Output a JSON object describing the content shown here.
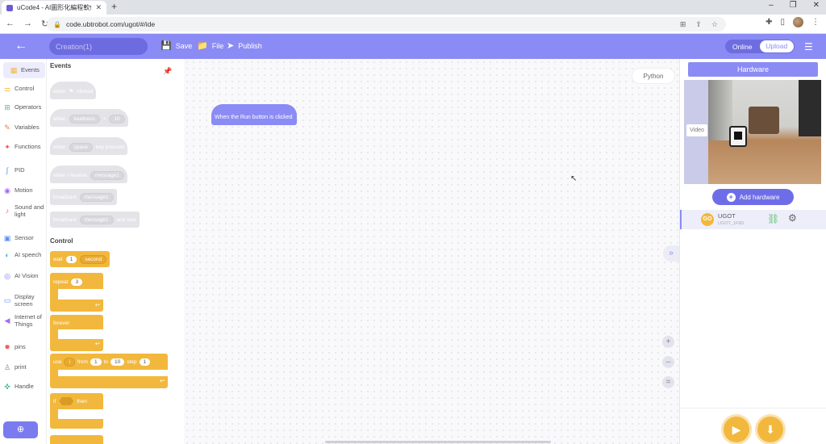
{
  "browser": {
    "tab_title": "uCode4 - AI圖形化編程軟件",
    "tab_close": "✕",
    "new_tab": "+",
    "url": "code.ubtrobot.com/ugot/#/ide",
    "win_min": "–",
    "win_max": "❐",
    "win_close": "✕"
  },
  "header": {
    "back_glyph": "←",
    "project_name": "Creation(1)",
    "save_label": "Save",
    "file_label": "File",
    "publish_label": "Publish",
    "mode_online": "Online",
    "mode_upload": "Upload"
  },
  "categories": [
    {
      "label": "Events",
      "icon": "calendar-icon",
      "color": "#f2b83d"
    },
    {
      "label": "Control",
      "icon": "sliders-icon",
      "color": "#f2b83d"
    },
    {
      "label": "Operators",
      "icon": "operators-icon",
      "color": "#59c08b"
    },
    {
      "label": "Variables",
      "icon": "variables-icon",
      "color": "#f27d3d"
    },
    {
      "label": "Functions",
      "icon": "functions-icon",
      "color": "#ec5a5a"
    },
    {
      "label": "PID",
      "icon": "pid-icon",
      "color": "#5b8ef0"
    },
    {
      "label": "Motion",
      "icon": "motion-icon",
      "color": "#a66bf0"
    },
    {
      "label": "Sound and light",
      "icon": "speaker-icon",
      "color": "#e85a9c"
    },
    {
      "label": "Sensor",
      "icon": "sensor-icon",
      "color": "#5b8ef0"
    },
    {
      "label": "AI speech",
      "icon": "speech-icon",
      "color": "#3dbcd6"
    },
    {
      "label": "AI Vision",
      "icon": "vision-icon",
      "color": "#7b7bf0"
    },
    {
      "label": "Display screen",
      "icon": "display-icon",
      "color": "#5b8ef0"
    },
    {
      "label": "Internet of Things",
      "icon": "iot-icon",
      "color": "#a66bf0"
    },
    {
      "label": "pins",
      "icon": "pins-icon",
      "color": "#ec5a5a"
    },
    {
      "label": "print",
      "icon": "print-icon",
      "color": "#888888"
    },
    {
      "label": "Handle",
      "icon": "gamepad-icon",
      "color": "#3dbc8f"
    }
  ],
  "palette": {
    "events_title": "Events",
    "control_title": "Control",
    "events_blocks": {
      "when_flag": {
        "when": "when",
        "clicked": "clicked"
      },
      "when_loudness": {
        "when": "when",
        "sensor": "loudness",
        "op": ">",
        "value": "10"
      },
      "when_key": {
        "when": "when",
        "key": "space",
        "pressed": "key pressed"
      },
      "when_receive": {
        "text": "when I receive",
        "msg": "message1"
      },
      "broadcast": {
        "text": "broadcast",
        "msg": "message1"
      },
      "broadcast_wait": {
        "text": "broadcast",
        "msg": "message1",
        "wait": "and wait"
      }
    },
    "control_blocks": {
      "wait": {
        "text": "wait",
        "value": "1",
        "unit": "second"
      },
      "repeat": {
        "text": "repeat",
        "value": "3"
      },
      "forever": {
        "text": "forever"
      },
      "use_loop": {
        "use": "use",
        "var": "i",
        "from": "from",
        "from_val": "1",
        "to": "to",
        "to_val": "10",
        "step": "step",
        "step_val": "1"
      },
      "if_then": {
        "if": "if",
        "then": "then"
      }
    }
  },
  "canvas": {
    "python_label": "Python",
    "hat_block_text": "When the Run button is clicked",
    "collapse_glyph": "»",
    "zoom_in": "+",
    "zoom_out": "–",
    "zoom_reset": "="
  },
  "hardware": {
    "tab_label": "Hardware",
    "video_label": "Video",
    "add_label": "Add hardware",
    "device_name": "UGOT",
    "device_id": "UGOT_1F8D",
    "device_logo": "GO"
  },
  "colors": {
    "accent": "#8b8bf5",
    "control_block": "#f2b83d",
    "events_block_disabled": "#e4e4e8",
    "connected": "#5bc36b"
  }
}
